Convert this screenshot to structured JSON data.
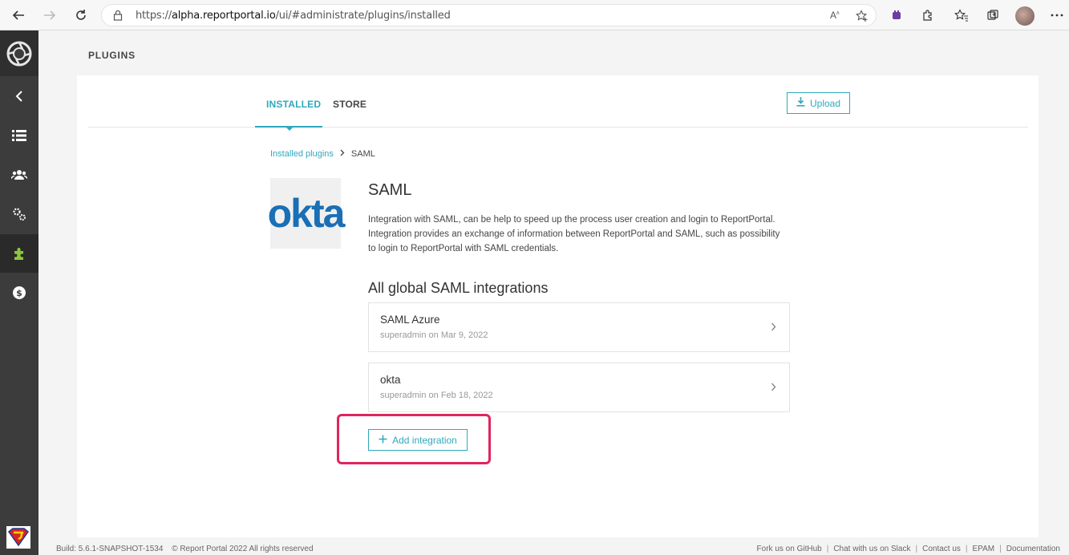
{
  "browser": {
    "url_prefix": "https://",
    "url_host": "alpha.reportportal.io",
    "url_path": "/ui/#administrate/plugins/installed"
  },
  "page": {
    "title": "PLUGINS"
  },
  "tabs": [
    {
      "label": "INSTALLED",
      "active": true
    },
    {
      "label": "STORE",
      "active": false
    }
  ],
  "upload_label": "Upload",
  "breadcrumb": {
    "link": "Installed plugins",
    "current": "SAML"
  },
  "plugin": {
    "logo_text": "okta",
    "title": "SAML",
    "description": "Integration with SAML, can be help to speed up the process user creation and login to ReportPortal. Integration provides an exchange of information between ReportPortal and SAML, such as possibility to login to ReportPortal with SAML credentials."
  },
  "integrations_title": "All global SAML integrations",
  "integrations": [
    {
      "name": "SAML Azure",
      "meta": "superadmin on Mar 9, 2022"
    },
    {
      "name": "okta",
      "meta": "superadmin on Feb 18, 2022"
    }
  ],
  "add_integration_label": "Add integration",
  "footer": {
    "build": "Build: 5.6.1-SNAPSHOT-1534",
    "copyright": "© Report Portal 2022 All rights reserved",
    "links": [
      "Fork us on GitHub",
      "Chat with us on Slack",
      "Contact us",
      "EPAM",
      "Documentation"
    ]
  },
  "colors": {
    "accent": "#2fa8bd",
    "highlight": "#e0245e",
    "sidebar": "#3c3c3c"
  }
}
